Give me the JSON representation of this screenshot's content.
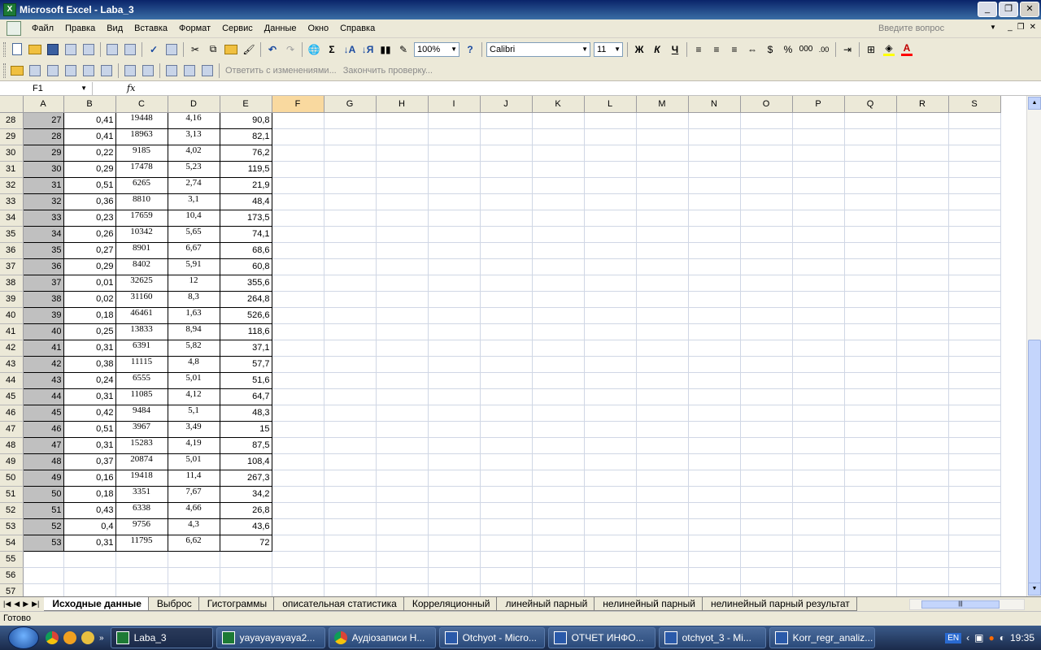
{
  "window": {
    "title": "Microsoft Excel - Laba_3"
  },
  "menu": [
    "Файл",
    "Правка",
    "Вид",
    "Вставка",
    "Формат",
    "Сервис",
    "Данные",
    "Окно",
    "Справка"
  ],
  "question_placeholder": "Введите вопрос",
  "toolbar": {
    "zoom": "100%",
    "font": "Calibri",
    "font_size": "11",
    "bold": "Ж",
    "italic": "К",
    "underline": "Ч",
    "sum": "Σ",
    "percent": "%",
    "thousands": "000",
    "reply_changes": "Ответить с изменениями...",
    "end_review": "Закончить проверку..."
  },
  "formula_bar": {
    "name_box": "F1",
    "fx": "fx",
    "value": ""
  },
  "columns": [
    "A",
    "B",
    "C",
    "D",
    "E",
    "F",
    "G",
    "H",
    "I",
    "J",
    "K",
    "L",
    "M",
    "N",
    "O",
    "P",
    "Q",
    "R",
    "S"
  ],
  "selected_column": "F",
  "rows": [
    {
      "r": "28",
      "a": "27",
      "b": "0,41",
      "c": "19448",
      "d": "4,16",
      "e": "90,8"
    },
    {
      "r": "29",
      "a": "28",
      "b": "0,41",
      "c": "18963",
      "d": "3,13",
      "e": "82,1"
    },
    {
      "r": "30",
      "a": "29",
      "b": "0,22",
      "c": "9185",
      "d": "4,02",
      "e": "76,2"
    },
    {
      "r": "31",
      "a": "30",
      "b": "0,29",
      "c": "17478",
      "d": "5,23",
      "e": "119,5"
    },
    {
      "r": "32",
      "a": "31",
      "b": "0,51",
      "c": "6265",
      "d": "2,74",
      "e": "21,9"
    },
    {
      "r": "33",
      "a": "32",
      "b": "0,36",
      "c": "8810",
      "d": "3,1",
      "e": "48,4"
    },
    {
      "r": "34",
      "a": "33",
      "b": "0,23",
      "c": "17659",
      "d": "10,4",
      "e": "173,5"
    },
    {
      "r": "35",
      "a": "34",
      "b": "0,26",
      "c": "10342",
      "d": "5,65",
      "e": "74,1"
    },
    {
      "r": "36",
      "a": "35",
      "b": "0,27",
      "c": "8901",
      "d": "6,67",
      "e": "68,6"
    },
    {
      "r": "37",
      "a": "36",
      "b": "0,29",
      "c": "8402",
      "d": "5,91",
      "e": "60,8"
    },
    {
      "r": "38",
      "a": "37",
      "b": "0,01",
      "c": "32625",
      "d": "12",
      "e": "355,6"
    },
    {
      "r": "39",
      "a": "38",
      "b": "0,02",
      "c": "31160",
      "d": "8,3",
      "e": "264,8"
    },
    {
      "r": "40",
      "a": "39",
      "b": "0,18",
      "c": "46461",
      "d": "1,63",
      "e": "526,6"
    },
    {
      "r": "41",
      "a": "40",
      "b": "0,25",
      "c": "13833",
      "d": "8,94",
      "e": "118,6"
    },
    {
      "r": "42",
      "a": "41",
      "b": "0,31",
      "c": "6391",
      "d": "5,82",
      "e": "37,1"
    },
    {
      "r": "43",
      "a": "42",
      "b": "0,38",
      "c": "11115",
      "d": "4,8",
      "e": "57,7"
    },
    {
      "r": "44",
      "a": "43",
      "b": "0,24",
      "c": "6555",
      "d": "5,01",
      "e": "51,6"
    },
    {
      "r": "45",
      "a": "44",
      "b": "0,31",
      "c": "11085",
      "d": "4,12",
      "e": "64,7"
    },
    {
      "r": "46",
      "a": "45",
      "b": "0,42",
      "c": "9484",
      "d": "5,1",
      "e": "48,3"
    },
    {
      "r": "47",
      "a": "46",
      "b": "0,51",
      "c": "3967",
      "d": "3,49",
      "e": "15"
    },
    {
      "r": "48",
      "a": "47",
      "b": "0,31",
      "c": "15283",
      "d": "4,19",
      "e": "87,5"
    },
    {
      "r": "49",
      "a": "48",
      "b": "0,37",
      "c": "20874",
      "d": "5,01",
      "e": "108,4"
    },
    {
      "r": "50",
      "a": "49",
      "b": "0,16",
      "c": "19418",
      "d": "11,4",
      "e": "267,3"
    },
    {
      "r": "51",
      "a": "50",
      "b": "0,18",
      "c": "3351",
      "d": "7,67",
      "e": "34,2"
    },
    {
      "r": "52",
      "a": "51",
      "b": "0,43",
      "c": "6338",
      "d": "4,66",
      "e": "26,8"
    },
    {
      "r": "53",
      "a": "52",
      "b": "0,4",
      "c": "9756",
      "d": "4,3",
      "e": "43,6"
    },
    {
      "r": "54",
      "a": "53",
      "b": "0,31",
      "c": "11795",
      "d": "6,62",
      "e": "72"
    }
  ],
  "empty_rows": [
    "55",
    "56",
    "57"
  ],
  "sheet_tabs": [
    {
      "label": "Исходные данные",
      "active": true
    },
    {
      "label": "Выброс",
      "active": false
    },
    {
      "label": "Гистограммы",
      "active": false
    },
    {
      "label": "описательная статистика",
      "active": false
    },
    {
      "label": "Корреляционный",
      "active": false
    },
    {
      "label": "линейный парный",
      "active": false
    },
    {
      "label": "нелинейный парный",
      "active": false
    },
    {
      "label": "нелинейный парный результат",
      "active": false
    }
  ],
  "status": "Готово",
  "taskbar": {
    "tasks": [
      {
        "label": "Laba_3",
        "icon": "excel-icon",
        "active": true
      },
      {
        "label": "yayayayayaya2...",
        "icon": "excel-icon",
        "active": false
      },
      {
        "label": "Аудіозаписи Н...",
        "icon": "chrome-icon",
        "active": false
      },
      {
        "label": "Otchyot - Micro...",
        "icon": "word-icon",
        "active": false
      },
      {
        "label": "ОТЧЕТ ИНФО...",
        "icon": "word-icon",
        "active": false
      },
      {
        "label": "otchyot_3 - Mi...",
        "icon": "word-icon",
        "active": false
      },
      {
        "label": "Korr_regr_analiz...",
        "icon": "word-icon",
        "active": false
      }
    ],
    "lang": "EN",
    "clock": "19:35"
  },
  "colors": {
    "titlebar": "#0a246a",
    "selected_header": "#f9d99f",
    "column_a_fill": "#c0c0c0",
    "taskbar": "#1a2a4a"
  }
}
